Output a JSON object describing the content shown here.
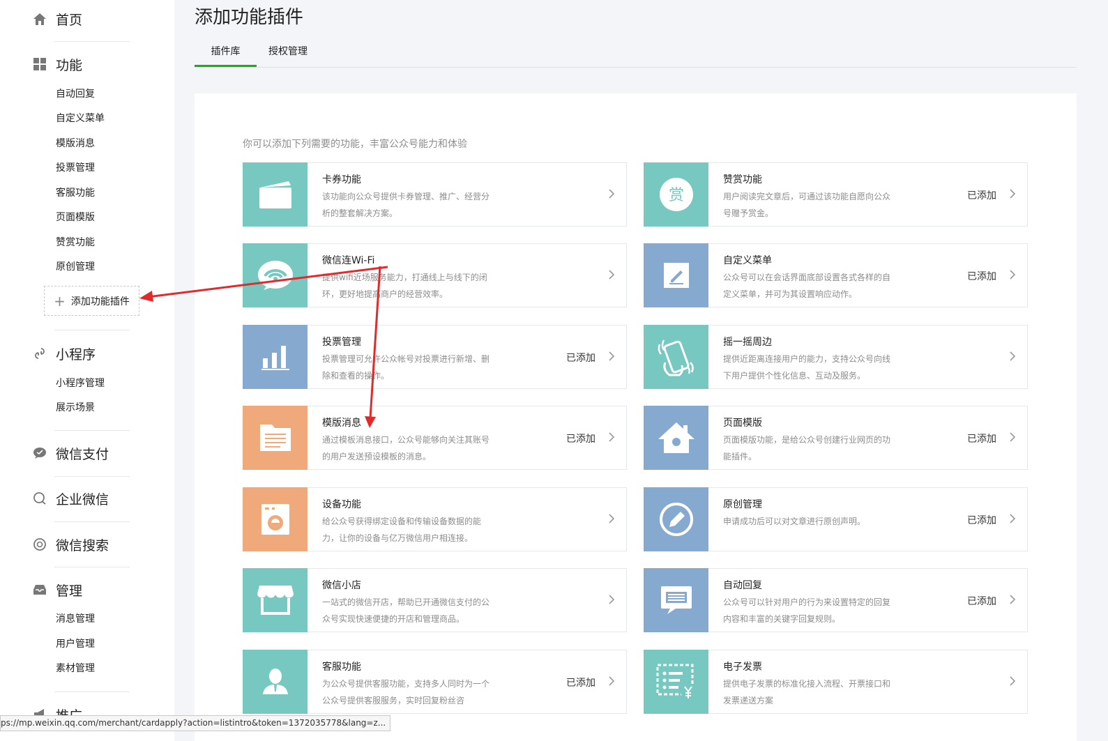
{
  "sidebar": {
    "home": {
      "label": "首页",
      "icon": "home-icon"
    },
    "functions": {
      "label": "功能",
      "icon": "grid-icon",
      "items": [
        "自动回复",
        "自定义菜单",
        "模版消息",
        "投票管理",
        "客服功能",
        "页面模版",
        "赞赏功能",
        "原创管理"
      ]
    },
    "add_plugin": {
      "label": "添加功能插件",
      "icon": "plus-icon"
    },
    "miniprogram": {
      "label": "小程序",
      "icon": "link-icon",
      "items": [
        "小程序管理",
        "展示场景"
      ]
    },
    "wechat_pay": {
      "label": "微信支付",
      "icon": "chat-bubble-icon"
    },
    "enterprise_wechat": {
      "label": "企业微信",
      "icon": "enterprise-chat-icon"
    },
    "wechat_search": {
      "label": "微信搜索",
      "icon": "search-icon"
    },
    "manage": {
      "label": "管理",
      "icon": "inbox-icon",
      "items": [
        "消息管理",
        "用户管理",
        "素材管理"
      ]
    },
    "promote": {
      "label": "推广",
      "icon": "megaphone-icon"
    }
  },
  "header": {
    "title": "添加功能插件"
  },
  "tabs": [
    {
      "label": "插件库",
      "active": true
    },
    {
      "label": "授权管理",
      "active": false
    }
  ],
  "intro": "你可以添加下列需要的功能，丰富公众号能力和体验",
  "colors": {
    "teal": "#76c8c0",
    "blue": "#86a9cf",
    "orange": "#f0a97b",
    "green": "#1aad19",
    "arrow_red": "#e22a2a"
  },
  "plugins": [
    {
      "title": "卡券功能",
      "desc": "该功能向公众号提供卡券管理、推广、经营分析的整套解决方案。",
      "added": "",
      "icon": "card-icon"
    },
    {
      "title": "赞赏功能",
      "desc": "用户阅读完文章后，可通过该功能自愿向公众号赠予赏金。",
      "added": "已添加",
      "icon": "reward-icon",
      "icon_text": "赏"
    },
    {
      "title": "微信连Wi-Fi",
      "desc": "提供wifi近场服务能力，打通线上与线下的闭环，更好地提高商户的经营效率。",
      "added": "",
      "icon": "wifi-icon"
    },
    {
      "title": "自定义菜单",
      "desc": "公众号可以在会话界面底部设置各式各样的自定义菜单，并可为其设置响应动作。",
      "added": "已添加",
      "icon": "edit-icon"
    },
    {
      "title": "投票管理",
      "desc": "投票管理可允许公众帐号对投票进行新增、删除和查看的操作。",
      "added": "已添加",
      "icon": "bar-chart-icon"
    },
    {
      "title": "摇一摇周边",
      "desc": "提供近距离连接用户的能力，支持公众号向线下用户提供个性化信息、互动及服务。",
      "added": "",
      "icon": "shake-phone-icon"
    },
    {
      "title": "模版消息",
      "desc": "通过模板消息接口，公众号能够向关注其账号的用户发送预设模板的消息。",
      "added": "已添加",
      "icon": "document-icon"
    },
    {
      "title": "页面模版",
      "desc": "页面模版功能，是给公众号创建行业网页的功能插件。",
      "added": "已添加",
      "icon": "house-icon"
    },
    {
      "title": "设备功能",
      "desc": "给公众号获得绑定设备和传输设备数据的能力，让你的设备与亿万微信用户相连接。",
      "added": "",
      "icon": "washer-icon"
    },
    {
      "title": "原创管理",
      "desc": "申请成功后可以对文章进行原创声明。",
      "added": "已添加",
      "icon": "pencil-circle-icon"
    },
    {
      "title": "微信小店",
      "desc": "一站式的微信开店，帮助已开通微信支付的公众号实现快速便捷的开店和管理商品。",
      "added": "",
      "icon": "shop-icon"
    },
    {
      "title": "自动回复",
      "desc": "公众号可以针对用户的行为来设置特定的回复内容和丰富的关键字回复规则。",
      "added": "已添加",
      "icon": "message-icon"
    },
    {
      "title": "客服功能",
      "desc": "为公众号提供客服功能，支持多人同时为一个公众号提供客服服务，实时回复粉丝咨",
      "added": "已添加",
      "icon": "agent-icon"
    },
    {
      "title": "电子发票",
      "desc": "提供电子发票的标准化接入流程、开票接口和发票递送方案",
      "added": "",
      "icon": "invoice-icon"
    }
  ],
  "status_url": "ps://mp.weixin.qq.com/merchant/cardapply?action=listintro&token=1372035778&lang=z..."
}
